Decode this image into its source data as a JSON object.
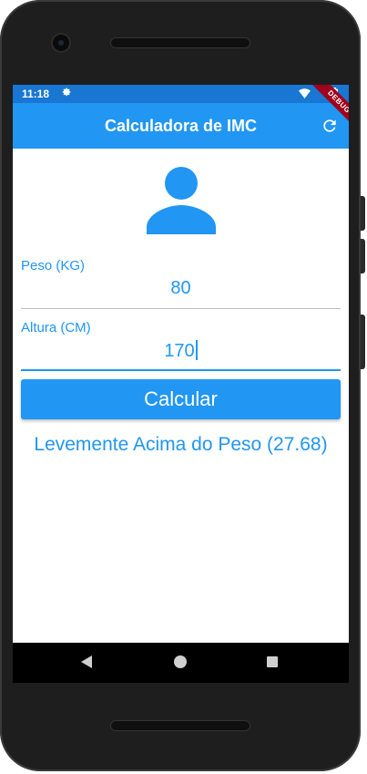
{
  "status_bar": {
    "time": "11:18",
    "icons": [
      "gear-icon",
      "wifi-icon",
      "battery-icon"
    ]
  },
  "app_bar": {
    "title": "Calculadora de IMC",
    "refresh_icon": "refresh-icon",
    "debug_banner": "DEBUG"
  },
  "avatar_icon": "person-icon",
  "form": {
    "weight": {
      "label": "Peso (KG)",
      "value": "80"
    },
    "height": {
      "label": "Altura (CM)",
      "value": "170"
    },
    "submit_label": "Calcular"
  },
  "result_text": "Levemente Acima do Peso (27.68)",
  "nav_bar": {
    "icons": [
      "back-icon",
      "home-icon",
      "recents-icon"
    ]
  },
  "colors": {
    "primary": "#2196f3",
    "status_bar": "#1976d2",
    "debug_banner": "#a0001c"
  }
}
